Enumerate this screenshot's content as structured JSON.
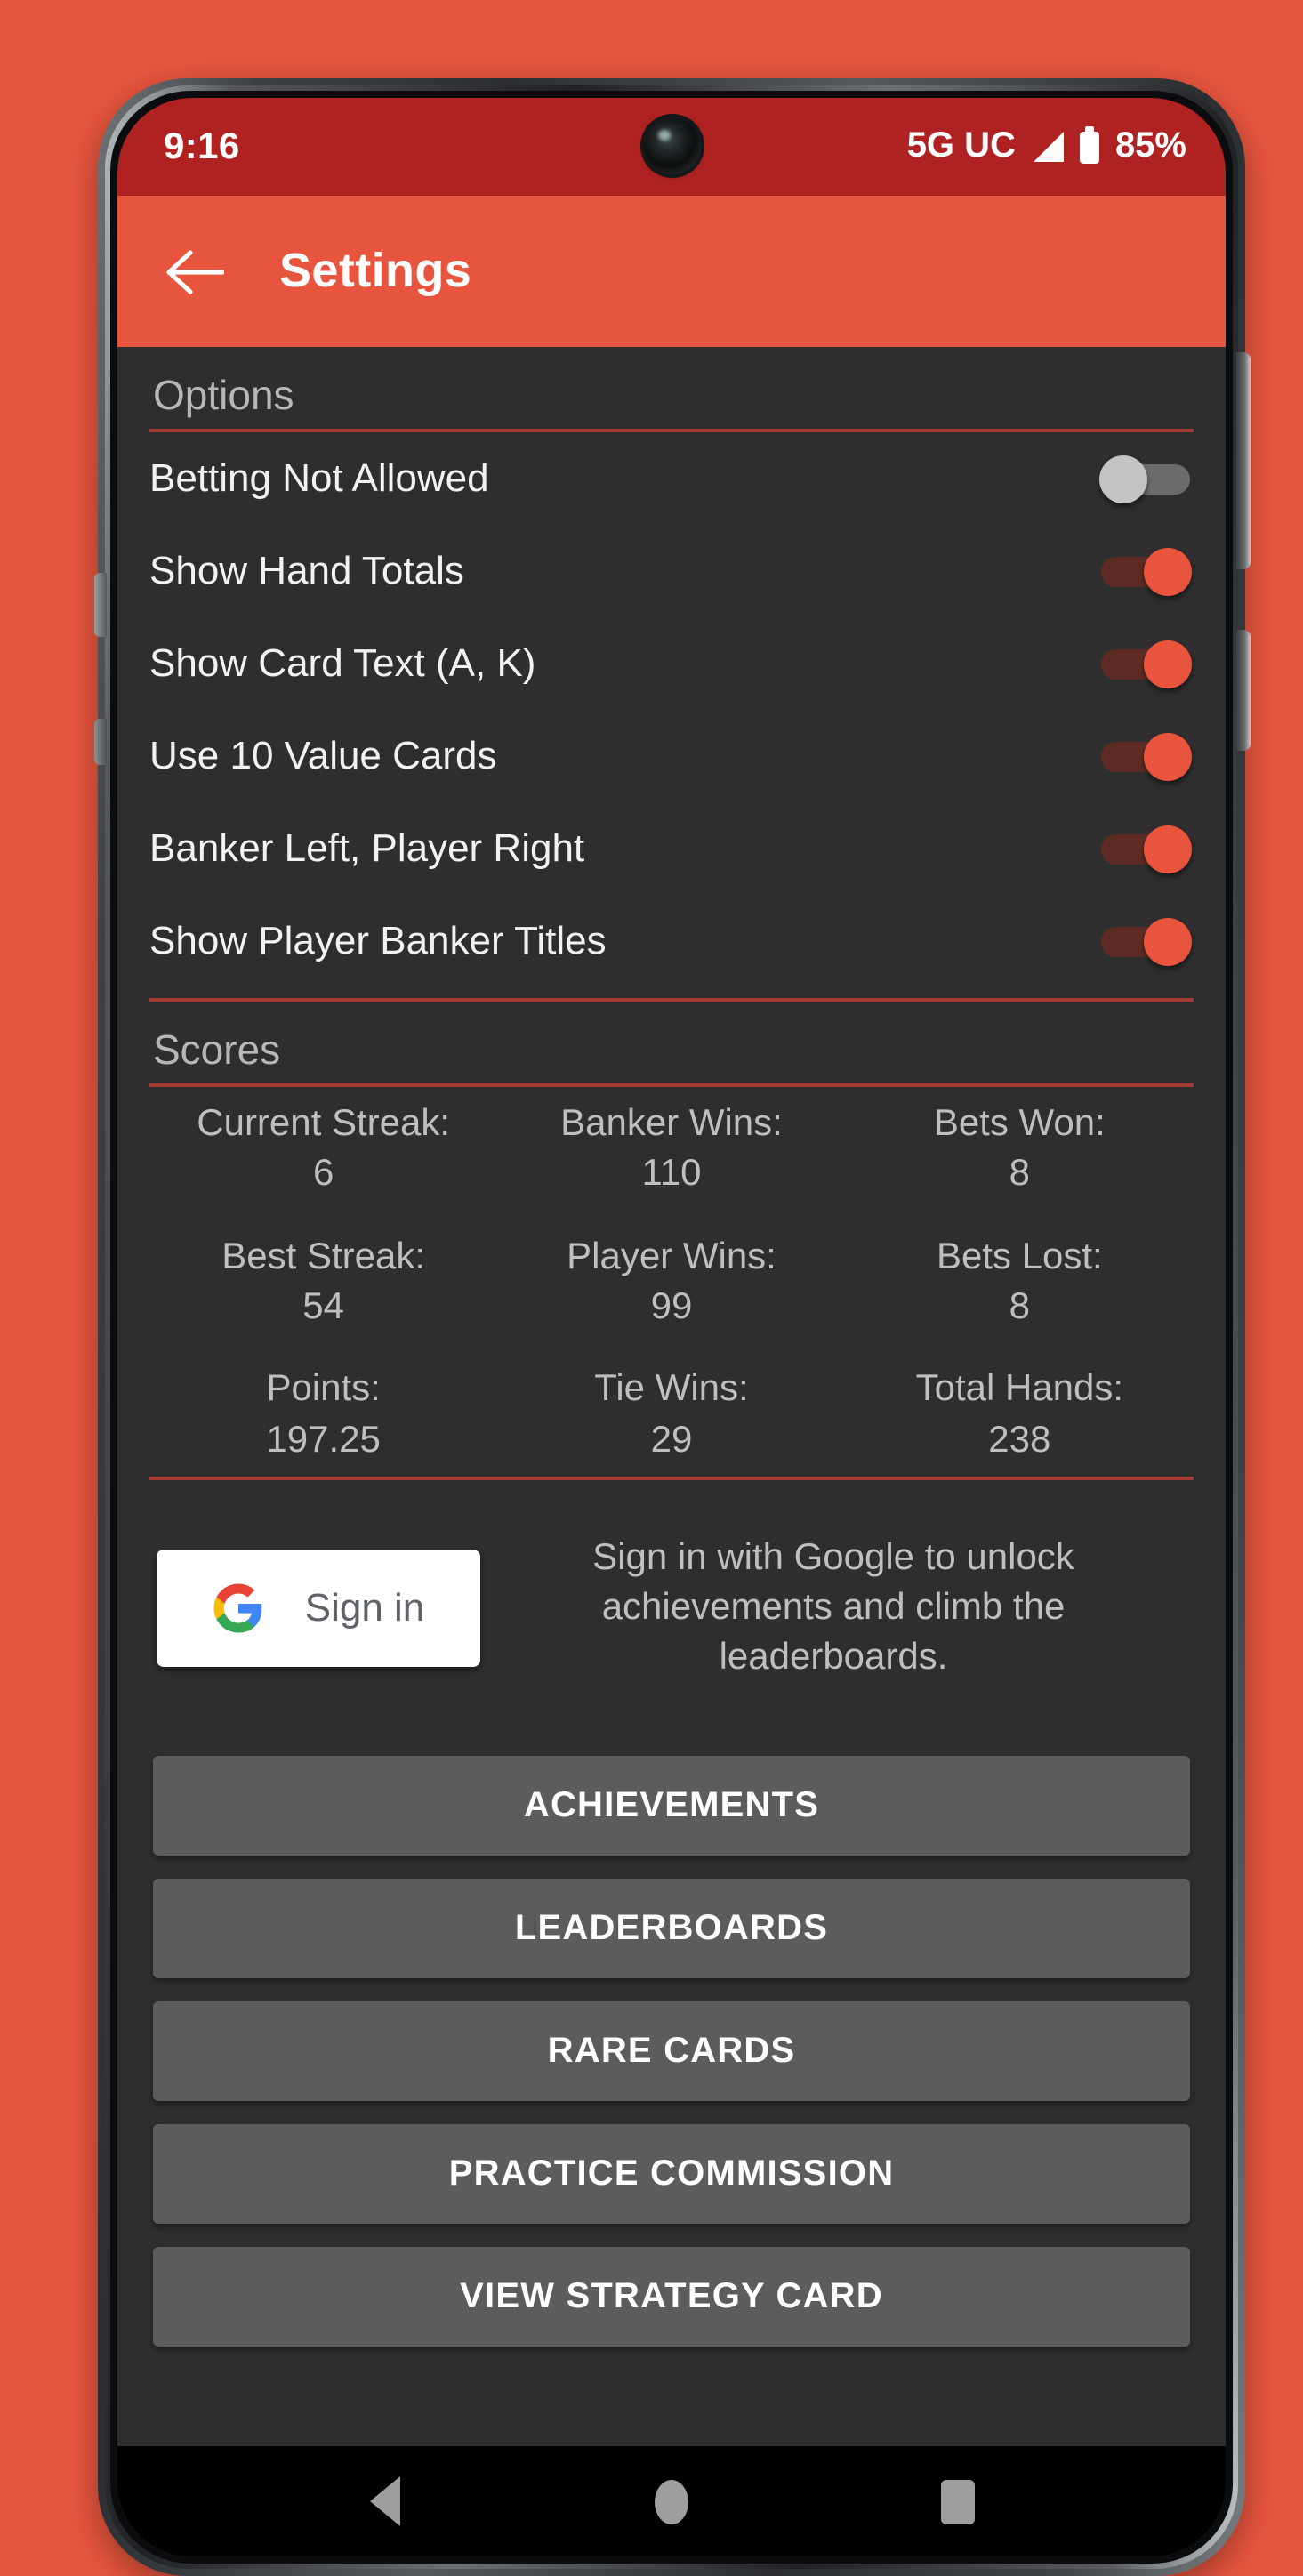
{
  "status_bar": {
    "time": "9:16",
    "network": "5G UC",
    "battery_percent": "85%",
    "signal_icon": "signal-triangle-icon",
    "battery_icon": "battery-icon"
  },
  "app_bar": {
    "back_icon": "arrow-left-icon",
    "title": "Settings"
  },
  "options": {
    "header": "Options",
    "items": [
      {
        "label": "Betting Not Allowed",
        "state": "off"
      },
      {
        "label": "Show Hand Totals",
        "state": "on"
      },
      {
        "label": "Show Card Text (A, K)",
        "state": "on"
      },
      {
        "label": "Use 10 Value Cards",
        "state": "on"
      },
      {
        "label": "Banker Left, Player Right",
        "state": "on"
      },
      {
        "label": "Show Player Banker Titles",
        "state": "on"
      }
    ]
  },
  "scores": {
    "header": "Scores",
    "cells": [
      {
        "label": "Current Streak:",
        "value": "6"
      },
      {
        "label": "Banker Wins:",
        "value": "110"
      },
      {
        "label": "Bets Won:",
        "value": "8"
      },
      {
        "label": "Best Streak:",
        "value": "54"
      },
      {
        "label": "Player Wins:",
        "value": "99"
      },
      {
        "label": "Bets Lost:",
        "value": "8"
      },
      {
        "label": "Points:",
        "value": "197.25"
      },
      {
        "label": "Tie Wins:",
        "value": "29"
      },
      {
        "label": "Total Hands:",
        "value": "238"
      }
    ]
  },
  "signin": {
    "button_label": "Sign in",
    "google_icon": "google-g-icon",
    "help_text": "Sign in with Google to unlock achievements and climb the leaderboards."
  },
  "actions": [
    {
      "label": "ACHIEVEMENTS"
    },
    {
      "label": "LEADERBOARDS"
    },
    {
      "label": "RARE CARDS"
    },
    {
      "label": "PRACTICE COMMISSION"
    },
    {
      "label": "VIEW STRATEGY CARD"
    }
  ],
  "nav_bar": {
    "back_icon": "nav-back-triangle-icon",
    "home_icon": "nav-home-circle-icon",
    "recents_icon": "nav-recents-square-icon"
  },
  "colors": {
    "page_background": "#E8553F",
    "status_bar": "#B02221",
    "app_bar": "#E8553F",
    "content_background": "#2E2E2E",
    "divider": "#A33A33",
    "toggle_on": "#E8543D",
    "toggle_off": "#C4C4C4",
    "action_button": "#5C5C5C"
  }
}
